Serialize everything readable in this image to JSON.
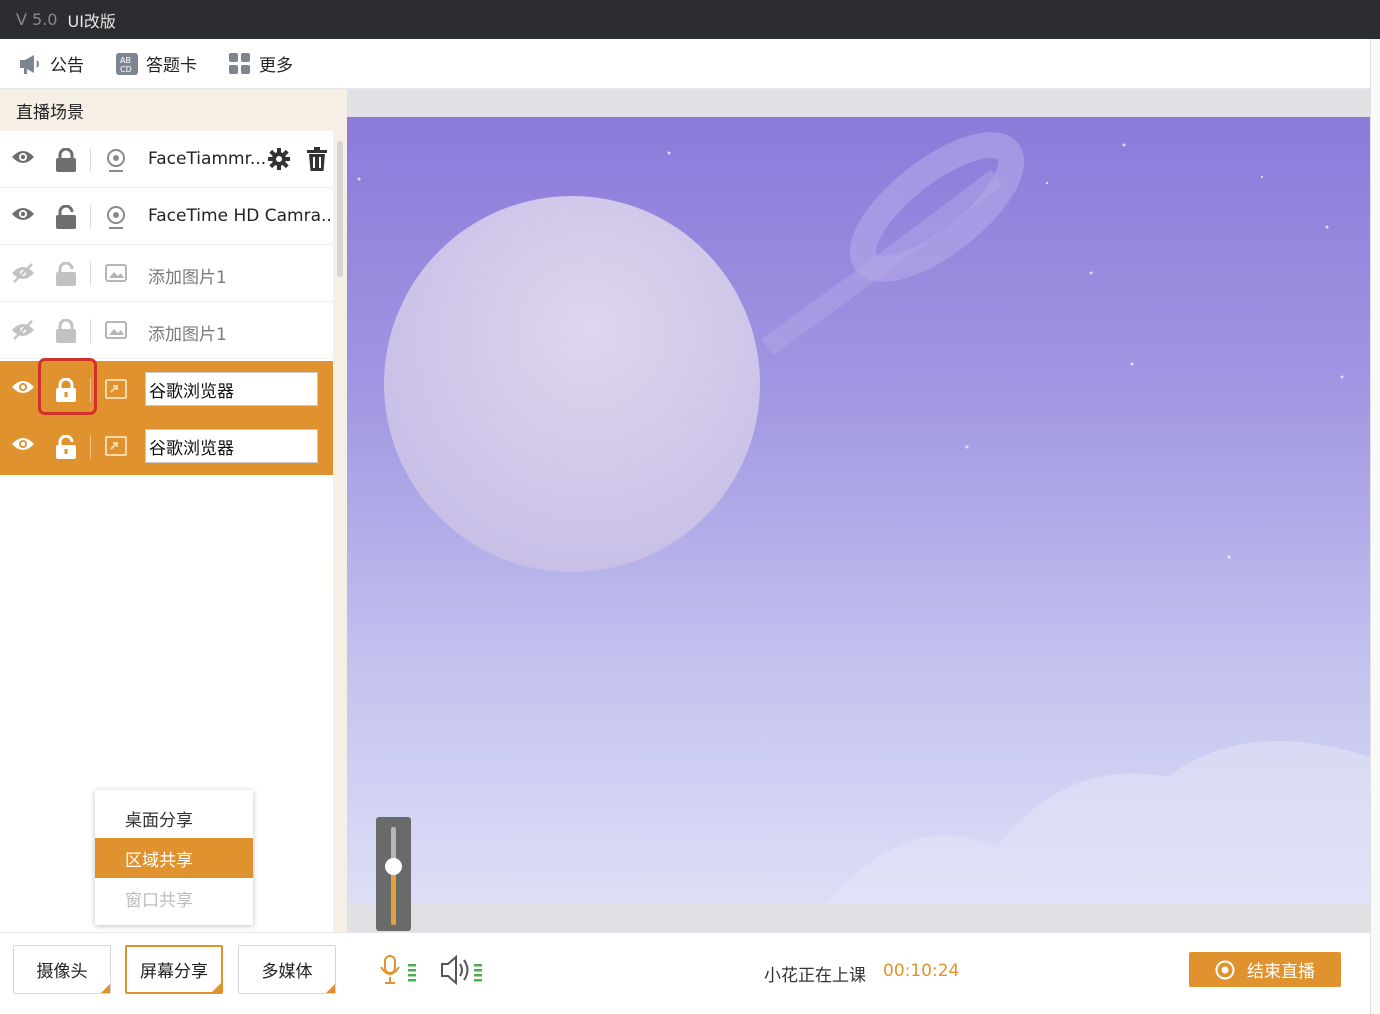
{
  "titlebar": {
    "version": "V 5.0",
    "title": "UI改版"
  },
  "toolbar": {
    "announce": "公告",
    "answer_card": "答题卡",
    "more": "更多"
  },
  "sidebar": {
    "title": "直播场景",
    "items": [
      {
        "name": "FaceTiammr...",
        "visible": true,
        "locked": true,
        "type": "camera"
      },
      {
        "name": "FaceTime HD Camra...",
        "visible": true,
        "locked": false,
        "type": "camera"
      },
      {
        "name": "添加图片1",
        "visible": false,
        "locked": false,
        "type": "image"
      },
      {
        "name": "添加图片1",
        "visible": false,
        "locked": true,
        "type": "image"
      },
      {
        "name": "谷歌浏览器",
        "visible": true,
        "locked": true,
        "type": "window",
        "selected": true
      },
      {
        "name": "谷歌浏览器",
        "visible": true,
        "locked": false,
        "type": "window",
        "selected": true
      }
    ]
  },
  "share_menu": {
    "options": [
      {
        "label": "桌面分享",
        "state": "normal"
      },
      {
        "label": "区域共享",
        "state": "active"
      },
      {
        "label": "窗口共享",
        "state": "disabled"
      }
    ]
  },
  "volume": {
    "level": 0.6
  },
  "bottom": {
    "camera_btn": "摄像头",
    "screen_share_btn": "屏幕分享",
    "multimedia_btn": "多媒体",
    "status": "小花正在上课",
    "timer": "00:10:24",
    "end_btn": "结束直播"
  },
  "colors": {
    "accent": "#e0922e",
    "titlebar": "#2c2d30",
    "highlight": "#d2302a"
  }
}
